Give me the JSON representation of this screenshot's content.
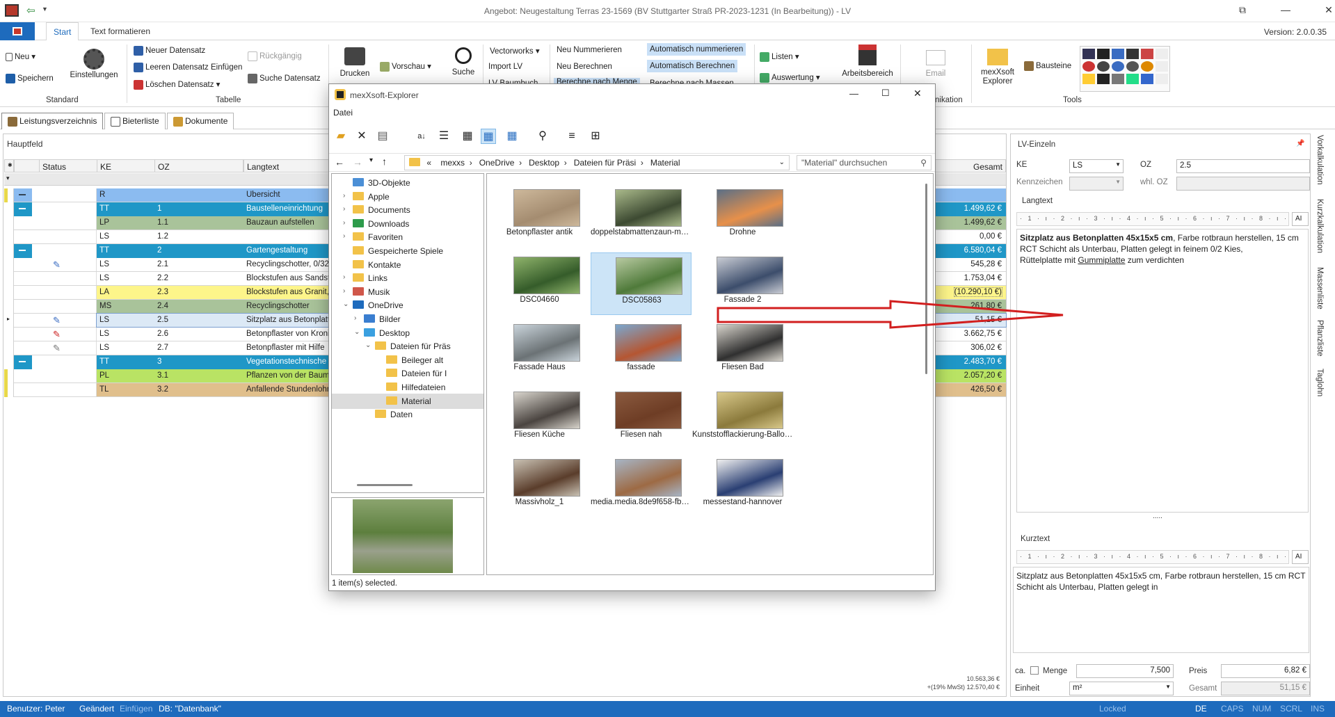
{
  "window": {
    "title": "Angebot: Neugestaltung Terras 23-1569 (BV Stuttgarter Straß PR-2023-1231 (In Bearbeitung)) - LV",
    "version": "Version: 2.0.0.35"
  },
  "ribbon_tabs": [
    "Start",
    "Text formatieren"
  ],
  "ribbon": {
    "neu": "Neu",
    "speichern": "Speichern",
    "einstellungen": "Einstellungen",
    "group_standard": "Standard",
    "neuer_datensatz": "Neuer Datensatz",
    "leeren_einfuegen": "Leeren Datensatz Einfügen",
    "loeschen": "Löschen Datensatz",
    "rueckgaengig": "Rückgängig",
    "suche_datensatz": "Suche Datensatz",
    "group_tabelle": "Tabelle",
    "drucken": "Drucken",
    "vorschau": "Vorschau",
    "suche": "Suche",
    "vectorworks": "Vectorworks",
    "import_lv": "Import LV",
    "baumbuch": "LV Baumbuch",
    "neu_nummerieren": "Neu Nummerieren",
    "neu_berechnen": "Neu Berechnen",
    "berechne_menge": "Berechne nach Menge",
    "auto_nummerieren": "Automatisch nummerieren",
    "auto_berechnen": "Automatisch Berechnen",
    "berechne_massen": "Berechne nach Massen",
    "listen": "Listen",
    "auswertung": "Auswertung",
    "arbeitsbereich": "Arbeitsbereich",
    "email": "Email",
    "kommunikation": "nikation",
    "mexxsoft_explorer": "mexXsoft Explorer",
    "bausteine": "Bausteine",
    "group_tools": "Tools"
  },
  "doc_tabs": [
    "Leistungsverzeichnis",
    "Bieterliste",
    "Dokumente"
  ],
  "main": {
    "hauptfeld": "Hauptfeld",
    "columns": [
      "Status",
      "KE",
      "OZ",
      "Langtext",
      "Gesamt"
    ],
    "rows": [
      {
        "ke": "R",
        "oz": "",
        "lt": "Übersicht",
        "gs": "",
        "bg": "#8bbbf0",
        "mark": "#e8d84a",
        "minus": true,
        "pin": ""
      },
      {
        "ke": "TT",
        "oz": "1",
        "lt": "Baustelleneinrichtung",
        "gs": "1.499,62 €",
        "bg": "#1f97c7",
        "mark": "",
        "minus": true,
        "pin": "",
        "fg": "#fff"
      },
      {
        "ke": "LP",
        "oz": "1.1",
        "lt": "Bauzaun aufstellen",
        "gs": "1.499,62 €",
        "bg": "#a9c39a",
        "mark": "",
        "minus": false,
        "pin": ""
      },
      {
        "ke": "LS",
        "oz": "1.2",
        "lt": "",
        "gs": "0,00 €",
        "bg": "#ffffff",
        "mark": "",
        "minus": false,
        "pin": ""
      },
      {
        "ke": "TT",
        "oz": "2",
        "lt": "Gartengestaltung",
        "gs": "6.580,04 €",
        "bg": "#1f97c7",
        "mark": "",
        "minus": true,
        "pin": "",
        "fg": "#fff"
      },
      {
        "ke": "LS",
        "oz": "2.1",
        "lt": "Recyclingschotter, 0/32",
        "gs": "545,28 €",
        "bg": "#ffffff",
        "mark": "",
        "minus": false,
        "pin": "blue"
      },
      {
        "ke": "LS",
        "oz": "2.2",
        "lt": "Blockstufen aus Sandst",
        "gs": "1.753,04 €",
        "bg": "#ffffff",
        "mark": "",
        "minus": false,
        "pin": ""
      },
      {
        "ke": "LA",
        "oz": "2.3",
        "lt": "Blockstufen aus Granit,",
        "gs": "(10.290,10 €)",
        "bg": "#fdf58a",
        "mark": "",
        "minus": false,
        "pin": ""
      },
      {
        "ke": "MS",
        "oz": "2.4",
        "lt": "Recyclingschotter",
        "gs": "261,80 €",
        "bg": "#a9c39a",
        "mark": "",
        "minus": false,
        "pin": ""
      },
      {
        "ke": "LS",
        "oz": "2.5",
        "lt": "Sitzplatz aus Betonplatt",
        "gs": "51,15 €",
        "bg": "#dce9f6",
        "mark": "",
        "minus": false,
        "pin": "blue",
        "sel": true
      },
      {
        "ke": "LS",
        "oz": "2.6",
        "lt": "Betonpflaster von Kroni",
        "gs": "3.662,75 €",
        "bg": "#ffffff",
        "mark": "",
        "minus": false,
        "pin": "red"
      },
      {
        "ke": "LS",
        "oz": "2.7",
        "lt": "Betonpflaster mit Hilfe",
        "gs": "306,02 €",
        "bg": "#ffffff",
        "mark": "",
        "minus": false,
        "pin": "gray"
      },
      {
        "ke": "TT",
        "oz": "3",
        "lt": "Vegetationstechnische",
        "gs": "2.483,70 €",
        "bg": "#1f97c7",
        "mark": "",
        "minus": true,
        "pin": "",
        "fg": "#fff"
      },
      {
        "ke": "PL",
        "oz": "3.1",
        "lt": "Pflanzen von der Baum",
        "gs": "2.057,20 €",
        "bg": "#b9e364",
        "mark": "#e8d84a",
        "minus": false,
        "pin": ""
      },
      {
        "ke": "TL",
        "oz": "3.2",
        "lt": "Anfallende Stundenlohn",
        "gs": "426,50 €",
        "bg": "#e0bf8c",
        "mark": "#e8d84a",
        "minus": false,
        "pin": ""
      }
    ],
    "total_net": "10.563,36 €",
    "total_gross": "+(19% MwSt) 12.570,40 €"
  },
  "lv_einzeln": {
    "title": "LV-Einzeln",
    "ke_label": "KE",
    "ke_value": "LS",
    "oz_label": "OZ",
    "oz_value": "2.5",
    "kennzeichen_label": "Kennzeichen",
    "whl_oz_label": "whl. OZ",
    "langtext_label": "Langtext",
    "ruler": "· 1 · ı · 2 · ı · 3 · ı · 4 · ı · 5 · ı · 6 · ı · 7 · ı · 8 · ı · 9 · ı",
    "langtext_bold": "Sitzplatz aus Betonplatten 45x15x5 cm",
    "langtext_rest": ", Farbe rotbraun herstellen, 15 cm RCT Schicht als Unterbau, Platten gelegt in feinem 0/2 Kies,",
    "langtext_line2_a": "Rüttelplatte mit ",
    "langtext_line2_b": "Gummiplatte",
    "langtext_line2_c": " zum verdichten",
    "kurztext_label": "Kurztext",
    "kurztext": "Sitzplatz aus Betonplatten 45x15x5 cm, Farbe rotbraun herstellen, 15 cm RCT Schicht als Unterbau, Platten gelegt in",
    "ca_label": "ca.",
    "menge_label": "Menge",
    "menge_value": "7,500",
    "preis_label": "Preis",
    "preis_value": "6,82 €",
    "einheit_label": "Einheit",
    "einheit_value": "m²",
    "gesamt_label": "Gesamt",
    "gesamt_value": "51,15 €",
    "ai": "AI",
    "dots": "....."
  },
  "side_tabs": [
    "Vorkalkulation",
    "Kurzkalkulation",
    "Massenliste",
    "Pflanzliste",
    "Taglohn"
  ],
  "statusbar": {
    "benutzer": "Benutzer: Peter",
    "geaendert": "Geändert",
    "einfuegen": "Einfügen",
    "db": "DB: \"Datenbank\"",
    "locked": "Locked",
    "de": "DE",
    "caps": "CAPS",
    "num": "NUM",
    "scrl": "SCRL",
    "ins": "INS"
  },
  "explorer": {
    "title": "mexXsoft-Explorer",
    "menu": "Datei",
    "breadcrumb": [
      "«",
      "mexxs",
      "OneDrive",
      "Desktop",
      "Dateien für Präsi",
      "Material"
    ],
    "search_placeholder": "\"Material\" durchsuchen",
    "tree": [
      {
        "label": "3D-Objekte",
        "indent": 0,
        "chev": "",
        "icon": "#4b8fd6"
      },
      {
        "label": "Apple",
        "indent": 0,
        "chev": ">",
        "icon": "#f2c249"
      },
      {
        "label": "Documents",
        "indent": 0,
        "chev": ">",
        "icon": "#f2c249"
      },
      {
        "label": "Downloads",
        "indent": 0,
        "chev": ">",
        "icon": "#2d9b4b"
      },
      {
        "label": "Favoriten",
        "indent": 0,
        "chev": ">",
        "icon": "#f2c249"
      },
      {
        "label": "Gespeicherte Spiele",
        "indent": 0,
        "chev": "",
        "icon": "#f2c249"
      },
      {
        "label": "Kontakte",
        "indent": 0,
        "chev": "",
        "icon": "#f2c249"
      },
      {
        "label": "Links",
        "indent": 0,
        "chev": ">",
        "icon": "#f2c249"
      },
      {
        "label": "Musik",
        "indent": 0,
        "chev": ">",
        "icon": "#d0574a"
      },
      {
        "label": "OneDrive",
        "indent": 0,
        "chev": "v",
        "icon": "#1e6bbd"
      },
      {
        "label": "Bilder",
        "indent": 1,
        "chev": ">",
        "icon": "#3a7ed0"
      },
      {
        "label": "Desktop",
        "indent": 1,
        "chev": "v",
        "icon": "#3aa0e0"
      },
      {
        "label": "Dateien für Präs",
        "indent": 2,
        "chev": "v",
        "icon": "#f2c249"
      },
      {
        "label": "Beileger alt",
        "indent": 3,
        "chev": "",
        "icon": "#f2c249"
      },
      {
        "label": "Dateien für I",
        "indent": 3,
        "chev": "",
        "icon": "#f2c249"
      },
      {
        "label": "Hilfedateien",
        "indent": 3,
        "chev": "",
        "icon": "#f2c249"
      },
      {
        "label": "Material",
        "indent": 3,
        "chev": "",
        "icon": "#f2c249",
        "sel": true
      },
      {
        "label": "Daten",
        "indent": 2,
        "chev": "",
        "icon": "#f2c249"
      }
    ],
    "files": [
      {
        "name": "Betonpflaster antik",
        "c1": "#a48c70",
        "c2": "#cdb89b"
      },
      {
        "name": "doppelstabmattenzaun-metall",
        "c1": "#3d4a32",
        "c2": "#a9b98a"
      },
      {
        "name": "Drohne",
        "c1": "#e7904a",
        "c2": "#5b6f86"
      },
      {
        "name": "DSC04660",
        "c1": "#355c2a",
        "c2": "#8fb36b"
      },
      {
        "name": "DSC05863",
        "c1": "#4f7a3a",
        "c2": "#b7c9a0",
        "sel": true
      },
      {
        "name": "Fassade 2",
        "c1": "#3c4d6b",
        "c2": "#c9ccd4"
      },
      {
        "name": "Fassade Haus",
        "c1": "#6b7275",
        "c2": "#c9d3da"
      },
      {
        "name": "fassade",
        "c1": "#b55632",
        "c2": "#7aa7cf"
      },
      {
        "name": "Fliesen Bad",
        "c1": "#303030",
        "c2": "#d8d4cc"
      },
      {
        "name": "Fliesen Küche",
        "c1": "#4a4440",
        "c2": "#d8d4cc"
      },
      {
        "name": "Fliesen nah",
        "c1": "#6e3d25",
        "c2": "#8a5a3f"
      },
      {
        "name": "Kunststofflackierung-Ballons-...",
        "c1": "#8b7a3c",
        "c2": "#d8c88a"
      },
      {
        "name": "Massivholz_1",
        "c1": "#5a3d2b",
        "c2": "#c8c0b2"
      },
      {
        "name": "media.media.8de9f658-fbd1-4f...",
        "c1": "#9d6a44",
        "c2": "#a7b4c4"
      },
      {
        "name": "messestand-hannover",
        "c1": "#2a3f73",
        "c2": "#f0f0f0"
      }
    ],
    "status": "1 item(s) selected."
  }
}
